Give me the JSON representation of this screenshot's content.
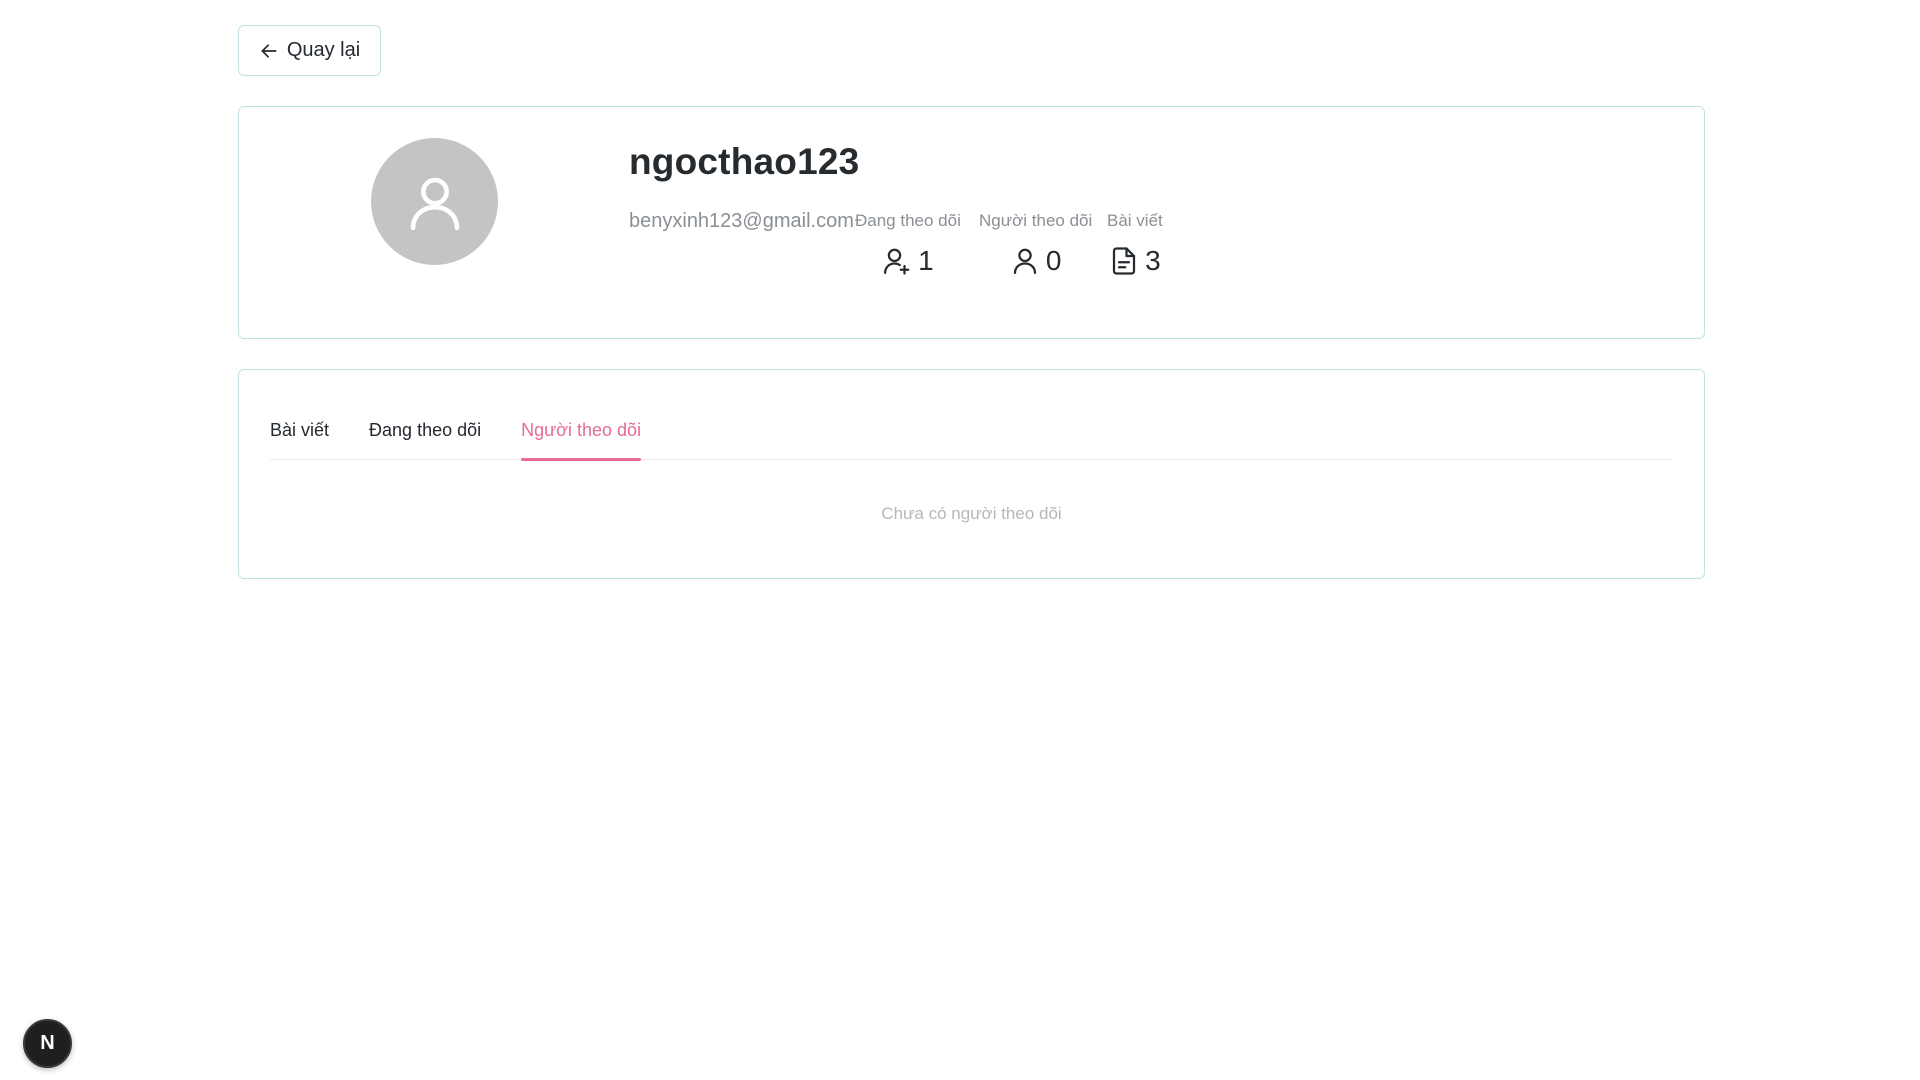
{
  "back_button": {
    "label": "Quay lại",
    "icon": "arrow-left-icon"
  },
  "profile": {
    "username": "ngocthao123",
    "email": "benyxinh123@gmail.com",
    "avatar_icon": "user-icon",
    "stats": {
      "following": {
        "label": "Đang theo dõi",
        "value": "1",
        "icon": "user-plus-icon"
      },
      "followers": {
        "label": "Người theo dõi",
        "value": "0",
        "icon": "user-icon"
      },
      "posts": {
        "label": "Bài viết",
        "value": "3",
        "icon": "file-text-icon"
      }
    }
  },
  "tabs": [
    {
      "label": "Bài viết",
      "active": false
    },
    {
      "label": "Đang theo dõi",
      "active": false
    },
    {
      "label": "Người theo dõi",
      "active": true
    }
  ],
  "empty_message": "Chưa có người theo dõi",
  "dev_badge": {
    "label": "N"
  },
  "colors": {
    "accent": "#e66b95",
    "border": "#bfe3e4",
    "avatar_bg": "#c4c4c4"
  }
}
